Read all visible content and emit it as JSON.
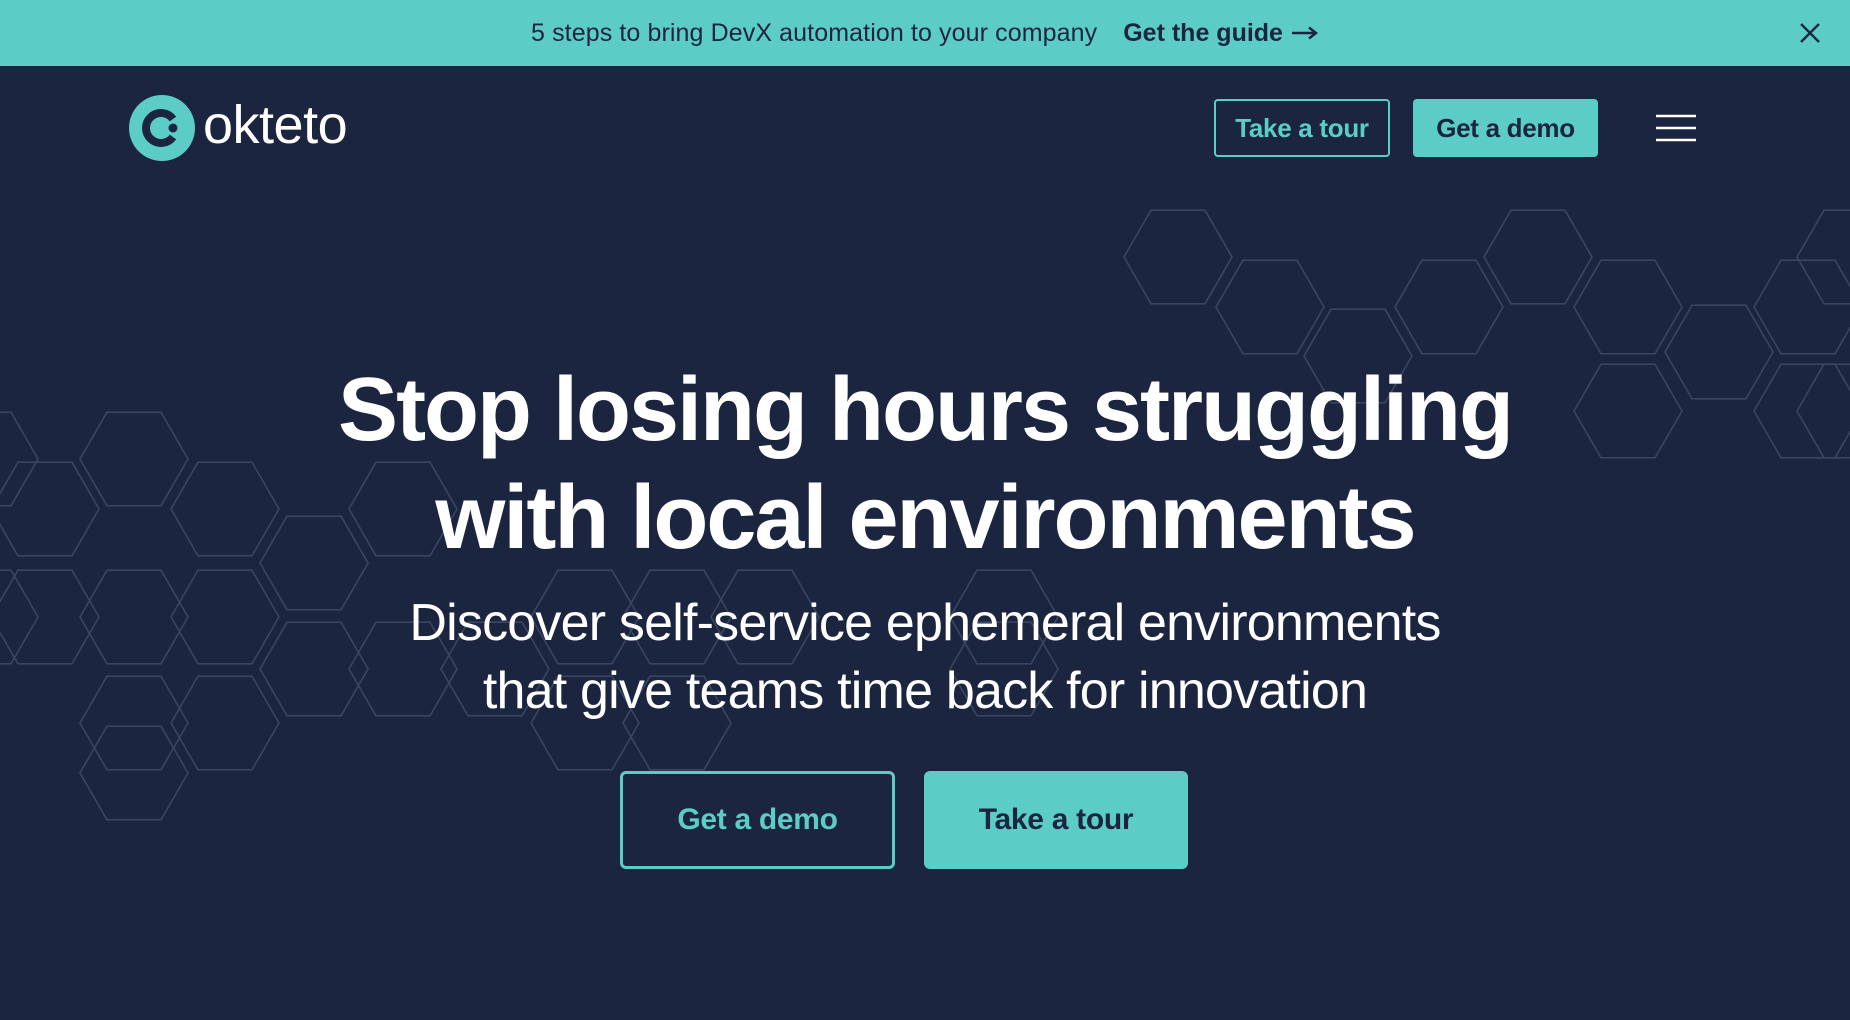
{
  "banner": {
    "text": "5 steps to bring DevX automation to your company",
    "link_label": "Get the guide",
    "close_icon": "close-icon"
  },
  "nav": {
    "logo_text": "okteto",
    "logo_icon": "okteto-logo-icon",
    "tour_label": "Take a tour",
    "demo_label": "Get a demo",
    "menu_icon": "hamburger-menu-icon"
  },
  "hero": {
    "title_line1": "Stop losing hours struggling",
    "title_line2": "with local environments",
    "subtitle_line1": "Discover self-service ephemeral environments",
    "subtitle_line2": "that give teams time back for innovation",
    "demo_label": "Get a demo",
    "tour_label": "Take a tour"
  },
  "colors": {
    "background": "#1c2540",
    "accent": "#5ccdc6",
    "text": "#ffffff"
  }
}
